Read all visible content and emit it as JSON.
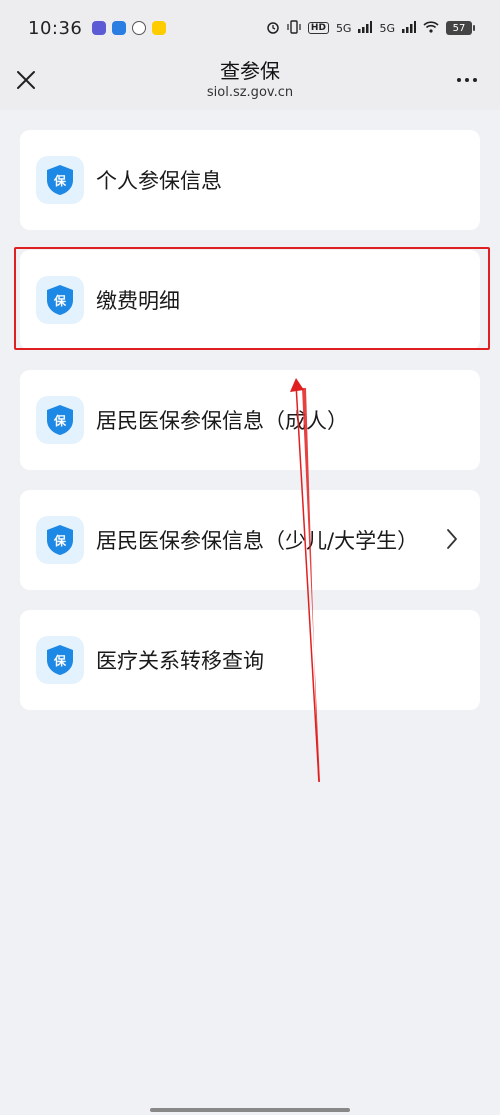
{
  "status_bar": {
    "time": "10:36",
    "hd": "HD",
    "signal_1": "5G",
    "signal_2": "5G",
    "battery": "57"
  },
  "nav": {
    "title": "查参保",
    "url": "siol.sz.gov.cn"
  },
  "menu": {
    "icon_glyph": "保",
    "items": [
      {
        "label": "个人参保信息"
      },
      {
        "label": "缴费明细"
      },
      {
        "label": "居民医保参保信息（成人）"
      },
      {
        "label": "居民医保参保信息（少儿/大学生）"
      },
      {
        "label": "医疗关系转移查询"
      }
    ]
  },
  "colors": {
    "accent": "#1e88e5",
    "icon_bg": "#e3f2fd",
    "annotation": "#e02020",
    "page_bg": "#f0f1f5"
  }
}
